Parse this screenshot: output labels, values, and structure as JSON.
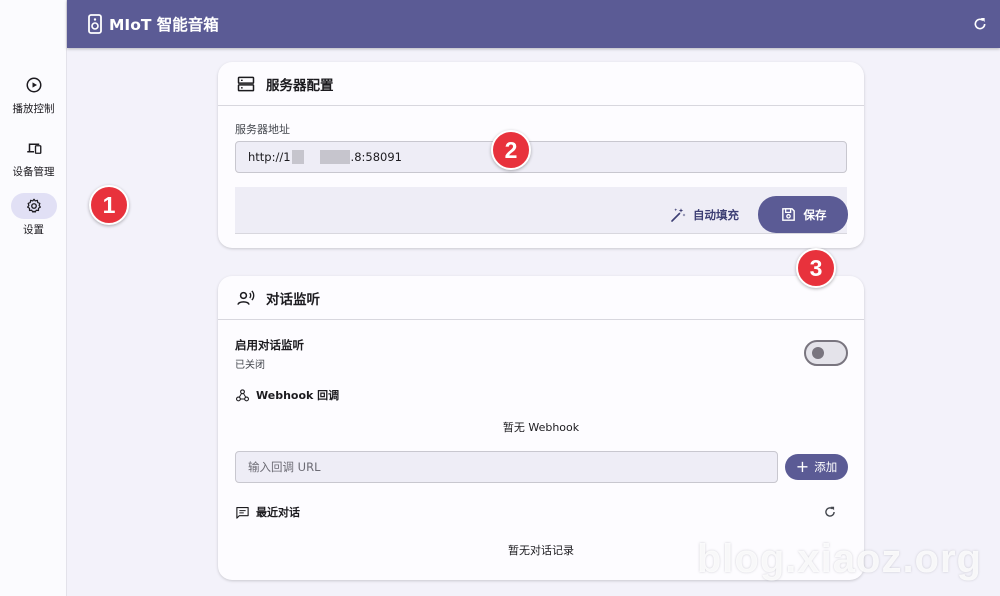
{
  "app": {
    "title": "MIoT 智能音箱"
  },
  "sidebar": {
    "items": [
      {
        "label": "播放控制",
        "icon": "play-circle-icon"
      },
      {
        "label": "设备管理",
        "icon": "devices-icon"
      },
      {
        "label": "设置",
        "icon": "gear-icon",
        "active": true
      }
    ]
  },
  "server_card": {
    "title": "服务器配置",
    "field_label": "服务器地址",
    "address_prefix": "http://1",
    "address_suffix": ".8:58091",
    "autofill_label": "自动填充",
    "save_label": "保存"
  },
  "monitor_card": {
    "title": "对话监听",
    "enable_title": "启用对话监听",
    "enable_status": "已关闭",
    "enabled": false,
    "webhook_label": "Webhook 回调",
    "webhook_empty": "暂无 Webhook",
    "url_placeholder": "输入回调 URL",
    "add_label": "添加",
    "recent_label": "最近对话",
    "recent_empty": "暂无对话记录"
  },
  "annotations": {
    "b1": "1",
    "b2": "2",
    "b3": "3"
  },
  "watermark": "blog.xiaoz.org",
  "colors": {
    "primary": "#5b5b95",
    "badge": "#e8323c",
    "surface": "#fdfcff",
    "background": "#f3f2fa"
  }
}
